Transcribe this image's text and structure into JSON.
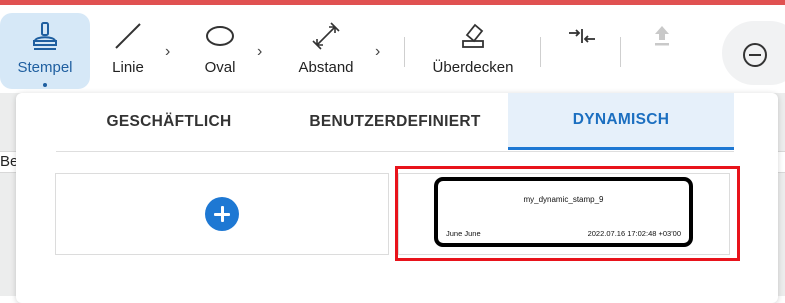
{
  "toolbar": {
    "tools": [
      {
        "label": "Stempel",
        "icon": "stamp-icon",
        "active": true
      },
      {
        "label": "Linie",
        "icon": "line-icon",
        "active": false
      },
      {
        "label": "Oval",
        "icon": "oval-icon",
        "active": false
      },
      {
        "label": "Abstand",
        "icon": "distance-icon",
        "active": false
      },
      {
        "label": "Überdecken",
        "icon": "eraser-icon",
        "active": false
      }
    ],
    "icons": {
      "collapse": "collapse-arrows-icon",
      "upload": "upload-icon",
      "zoom_out": "zoom-out-icon"
    }
  },
  "background_text": "Be",
  "tabs": [
    {
      "label": "GESCHÄFTLICH",
      "active": false
    },
    {
      "label": "BENUTZERDEFINIERT",
      "active": false
    },
    {
      "label": "DYNAMISCH",
      "active": true
    }
  ],
  "stamp": {
    "title": "my_dynamic_stamp_9",
    "author": "June June",
    "timestamp": "2022.07.16 17:02:48 +03'00"
  },
  "colors": {
    "accent": "#1e78d3",
    "active_bg": "#d6e8f7",
    "highlight": "#e8131b",
    "top_bar": "#e05151"
  }
}
